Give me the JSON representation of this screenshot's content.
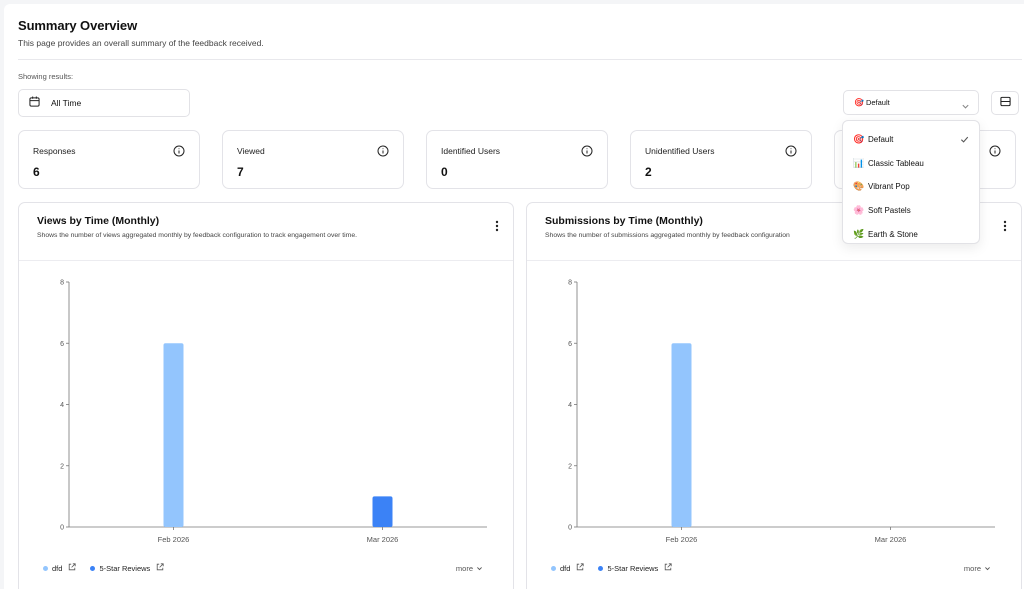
{
  "header": {
    "title": "Summary Overview",
    "subtitle": "This page provides an overall summary of the feedback received."
  },
  "filters": {
    "showing_label": "Showing results:",
    "date_range": "All Time"
  },
  "palette": {
    "selected_label": "Default",
    "selected_icon": "🎯",
    "options": [
      {
        "icon": "🎯",
        "label": "Default",
        "selected": true
      },
      {
        "icon": "📊",
        "label": "Classic Tableau",
        "selected": false
      },
      {
        "icon": "🎨",
        "label": "Vibrant Pop",
        "selected": false
      },
      {
        "icon": "🌸",
        "label": "Soft Pastels",
        "selected": false
      },
      {
        "icon": "🌿",
        "label": "Earth & Stone",
        "selected": false
      }
    ]
  },
  "stats": [
    {
      "label": "Responses",
      "value": "6"
    },
    {
      "label": "Viewed",
      "value": "7"
    },
    {
      "label": "Identified Users",
      "value": "0"
    },
    {
      "label": "Unidentified Users",
      "value": "2"
    }
  ],
  "charts": [
    {
      "title": "Views by Time (Monthly)",
      "description": "Shows the number of views aggregated monthly by feedback configuration to track engagement over time.",
      "legend": [
        {
          "name": "dfd",
          "color": "#93c5fd"
        },
        {
          "name": "5-Star Reviews",
          "color": "#3b82f6"
        }
      ],
      "more_label": "more"
    },
    {
      "title": "Submissions by Time (Monthly)",
      "description": "Shows the number of submissions aggregated monthly by feedback configuration",
      "legend": [
        {
          "name": "dfd",
          "color": "#93c5fd"
        },
        {
          "name": "5-Star Reviews",
          "color": "#3b82f6"
        }
      ],
      "more_label": "more"
    }
  ],
  "chart_data": [
    {
      "type": "bar",
      "categories": [
        "Feb 2026",
        "Mar 2026"
      ],
      "series": [
        {
          "name": "dfd",
          "values": [
            6,
            0
          ],
          "color": "#93c5fd"
        },
        {
          "name": "5-Star Reviews",
          "values": [
            0,
            1
          ],
          "color": "#3b82f6"
        }
      ],
      "title": "Views by Time (Monthly)",
      "ylim": [
        0,
        8
      ],
      "yticks": [
        0,
        2,
        4,
        6,
        8
      ],
      "grid": false,
      "legend": "bottom-left"
    },
    {
      "type": "bar",
      "categories": [
        "Feb 2026",
        "Mar 2026"
      ],
      "series": [
        {
          "name": "dfd",
          "values": [
            6,
            0
          ],
          "color": "#93c5fd"
        },
        {
          "name": "5-Star Reviews",
          "values": [
            0,
            0
          ],
          "color": "#3b82f6"
        }
      ],
      "title": "Submissions by Time (Monthly)",
      "ylim": [
        0,
        8
      ],
      "yticks": [
        0,
        2,
        4,
        6,
        8
      ],
      "grid": false,
      "legend": "bottom-left"
    }
  ]
}
